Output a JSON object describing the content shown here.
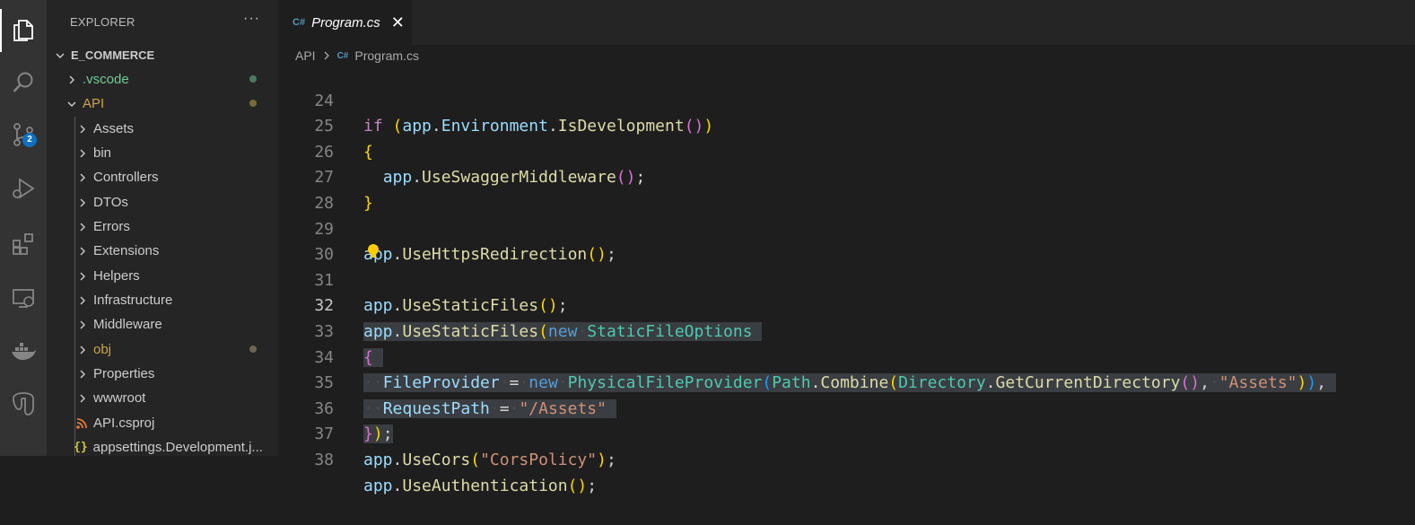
{
  "activity_bar": {
    "items": [
      {
        "icon": "files-icon",
        "active": true
      },
      {
        "icon": "search-icon"
      },
      {
        "icon": "source-control-icon",
        "badge": "2"
      },
      {
        "icon": "run-debug-icon"
      },
      {
        "icon": "extensions-icon"
      },
      {
        "icon": "remote-explorer-icon"
      },
      {
        "icon": "docker-icon"
      },
      {
        "icon": "database-icon"
      }
    ],
    "badge_color": "#0e70c0"
  },
  "sidebar": {
    "title": "EXPLORER",
    "more": "···",
    "root": "E_COMMERCE",
    "items": [
      {
        "label": ".vscode",
        "color": "#73c991",
        "dot": "#4d7a5f",
        "kind": "folder"
      },
      {
        "label": "API",
        "color": "#c9a44f",
        "dot": "#7a6a37",
        "kind": "folder-open"
      },
      {
        "label": "Assets",
        "kind": "folder"
      },
      {
        "label": "bin",
        "kind": "folder"
      },
      {
        "label": "Controllers",
        "kind": "folder"
      },
      {
        "label": "DTOs",
        "kind": "folder"
      },
      {
        "label": "Errors",
        "kind": "folder"
      },
      {
        "label": "Extensions",
        "kind": "folder"
      },
      {
        "label": "Helpers",
        "kind": "folder"
      },
      {
        "label": "Infrastructure",
        "kind": "folder"
      },
      {
        "label": "Middleware",
        "kind": "folder"
      },
      {
        "label": "obj",
        "color": "#c9a44f",
        "dot": "#6e6450",
        "kind": "folder"
      },
      {
        "label": "Properties",
        "kind": "folder"
      },
      {
        "label": "wwwroot",
        "kind": "folder"
      },
      {
        "label": "API.csproj",
        "kind": "file-rss"
      },
      {
        "label": "appsettings.Development.j...",
        "kind": "file-json"
      }
    ]
  },
  "tab": {
    "icon_text": "C#",
    "label": "Program.cs",
    "close": "✕"
  },
  "breadcrumb": {
    "parts": [
      "API",
      "Program.cs"
    ],
    "icon_text": "C#"
  },
  "editor": {
    "current_line": 32,
    "lines": [
      {
        "n": "24",
        "text": "if (app.Environment.IsDevelopment())"
      },
      {
        "n": "25",
        "text": "{"
      },
      {
        "n": "26",
        "text": "  app.UseSwaggerMiddleware();"
      },
      {
        "n": "27",
        "text": "}"
      },
      {
        "n": "28",
        "text": ""
      },
      {
        "n": "29",
        "text": "app.UseHttpsRedirection();"
      },
      {
        "n": "30",
        "text": ""
      },
      {
        "n": "31",
        "text": "app.UseStaticFiles();"
      },
      {
        "n": "32",
        "text": "app.UseStaticFiles(new StaticFileOptions"
      },
      {
        "n": "33",
        "text": "{"
      },
      {
        "n": "34",
        "text": "  FileProvider = new PhysicalFileProvider(Path.Combine(Directory.GetCurrentDirectory(), \"Assets\")),"
      },
      {
        "n": "35",
        "text": "  RequestPath = \"/Assets\""
      },
      {
        "n": "36",
        "text": "});"
      },
      {
        "n": "37",
        "text": "app.UseCors(\"CorsPolicy\");"
      },
      {
        "n": "38",
        "text": "app.UseAuthentication();"
      }
    ]
  },
  "colors": {
    "keyword": "#569cd6",
    "control": "#c586c0",
    "variable": "#9cdcfe",
    "function": "#dcdcaa",
    "type": "#4ec9b0",
    "string": "#ce9178",
    "selection": "#3a3d41"
  }
}
